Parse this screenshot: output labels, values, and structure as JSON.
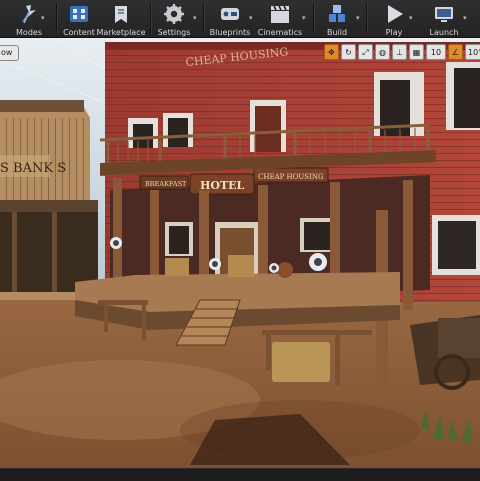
{
  "toolbar": {
    "buttons": [
      {
        "label": "Modes",
        "icon": "modes-icon"
      },
      {
        "label": "Content",
        "icon": "content-icon"
      },
      {
        "label": "Marketplace",
        "icon": "marketplace-icon"
      },
      {
        "label": "Settings",
        "icon": "gear-icon"
      },
      {
        "label": "Blueprints",
        "icon": "blueprints-icon"
      },
      {
        "label": "Cinematics",
        "icon": "clapperboard-icon"
      },
      {
        "label": "Build",
        "icon": "build-icon"
      },
      {
        "label": "Play",
        "icon": "play-icon"
      },
      {
        "label": "Launch",
        "icon": "launch-icon"
      }
    ]
  },
  "viewport": {
    "view_label": "ow",
    "grid_snap_value": "10",
    "rotation_snap_value": "10°",
    "signs": {
      "roof_sign": "CHEAP HOUSING",
      "bank_sign": "S BANK S",
      "breakfast_sign": "BREAKFAST",
      "hotel_sign": "HOTEL",
      "porch_sign": "CHEAP HOUSING"
    }
  },
  "colors": {
    "toolbar_bg": "#2a2a2a",
    "accent_orange": "#e08a2c",
    "building_red": "#a53a30",
    "ground_dirt": "#8a5a38"
  }
}
